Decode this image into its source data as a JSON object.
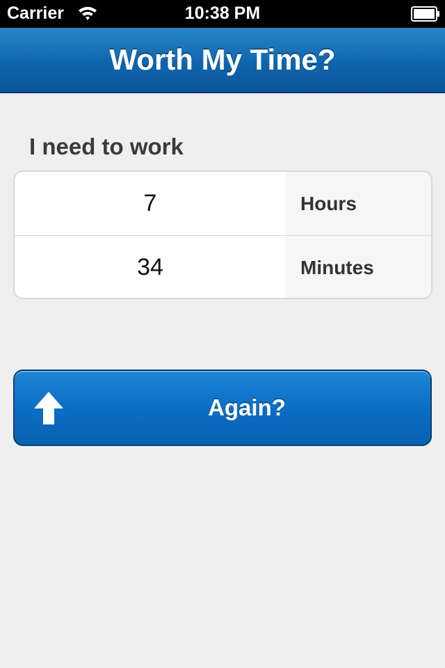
{
  "status_bar": {
    "carrier": "Carrier",
    "time": "10:38 PM",
    "wifi_icon": "wifi-icon",
    "battery_icon": "battery-icon"
  },
  "nav": {
    "title": "Worth My Time?"
  },
  "section": {
    "label": "I need to work"
  },
  "rows": [
    {
      "value": "7",
      "unit": "Hours"
    },
    {
      "value": "34",
      "unit": "Minutes"
    }
  ],
  "action": {
    "label": "Again?",
    "icon": "up-arrow-icon"
  },
  "colors": {
    "accent": "#0b6ec5",
    "background": "#efefef",
    "nav_bar": "#0f65ad"
  }
}
